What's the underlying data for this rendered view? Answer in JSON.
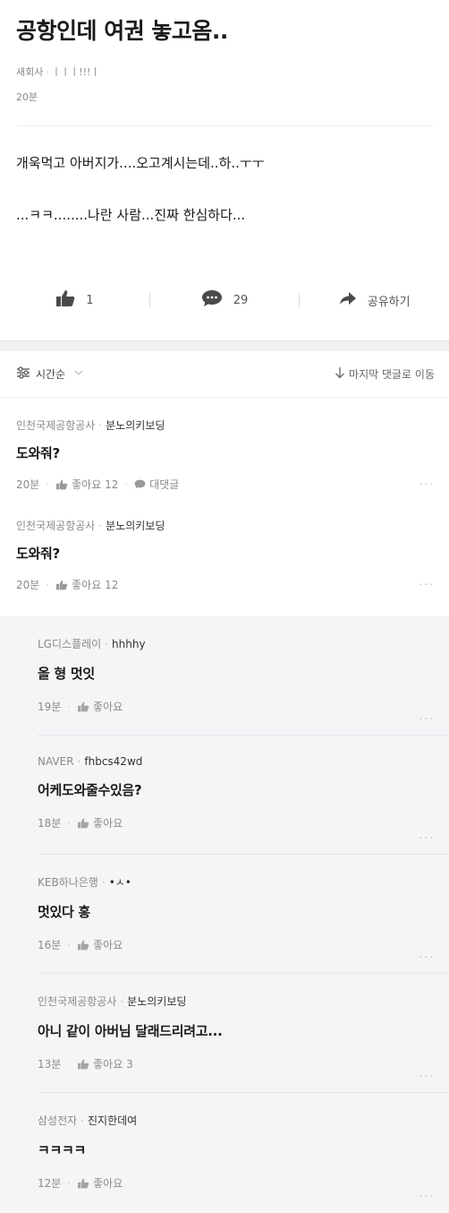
{
  "post": {
    "title": "공항인데 여권 놓고옴..",
    "company": "새회사",
    "author": "ㅣㅣㅣ!!!ㅣ",
    "time": "20분",
    "body_line1": "개욱먹고 아버지가....오고계시는데..하..ㅜㅜ",
    "body_line2": "...ㅋㅋ........나란 사람...진짜 한심하다...",
    "like_count": "1",
    "comment_count": "29",
    "share_label": "공유하기"
  },
  "sortbar": {
    "sort_label": "시간순",
    "jump_label": "마지막 댓글로 이동"
  },
  "comments": [
    {
      "company": "인천국제공항공사",
      "nick": "분노의키보딩",
      "text": "도와줘?",
      "time": "20분",
      "likes": "좋아요 12",
      "reply_label": "대댓글"
    },
    {
      "company": "인천국제공항공사",
      "nick": "분노의키보딩",
      "text": "도와줘?",
      "time": "20분",
      "likes": "좋아요 12"
    }
  ],
  "replies": [
    {
      "company": "LG디스플레이",
      "nick": "hhhhy",
      "text": "올 형 멋잇",
      "time": "19분",
      "likes": "좋아요"
    },
    {
      "company": "NAVER",
      "nick": "fhbcs42wd",
      "text": "어케도와줄수있음?",
      "time": "18분",
      "likes": "좋아요"
    },
    {
      "company": "KEB하나은행",
      "nick": "•ㅅ•",
      "text": "멋있다 홍",
      "time": "16분",
      "likes": "좋아요"
    },
    {
      "company": "인천국제공항공사",
      "nick": "분노의키보딩",
      "text": "아니 같이 아버님 달래드리려고...",
      "time": "13분",
      "likes": "좋아요 3"
    },
    {
      "company": "삼성전자",
      "nick": "진지한데여",
      "text": "ㅋㅋㅋㅋ",
      "time": "12분",
      "likes": "좋아요"
    }
  ],
  "more_label": "...",
  "icons": [
    "thumbs-up-icon",
    "speech-bubble-icon",
    "share-arrow-icon",
    "sort-icon",
    "down-arrow-icon",
    "chevron-down-icon"
  ]
}
